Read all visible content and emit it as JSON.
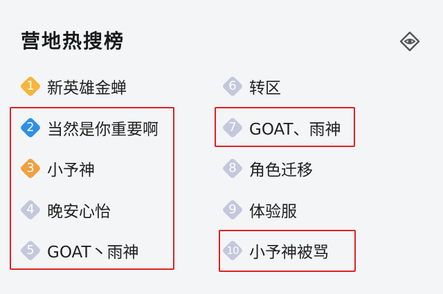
{
  "title": "营地热搜榜",
  "colors": {
    "rank1": "#f5b63a",
    "rank2": "#2f8fe6",
    "rank3": "#f0a040",
    "rankOther": "#c3c8dc",
    "highlight": "#e02020"
  },
  "icons": {
    "more": "diamond-eye-icon"
  },
  "items": [
    {
      "rank": "1",
      "label": "新英雄金蝉",
      "color": "#f5b63a"
    },
    {
      "rank": "2",
      "label": "当然是你重要啊",
      "color": "#2f8fe6"
    },
    {
      "rank": "3",
      "label": "小予神",
      "color": "#f0a040"
    },
    {
      "rank": "4",
      "label": "晚安心怡",
      "color": "#c3c8dc"
    },
    {
      "rank": "5",
      "label": "GOAT丶雨神",
      "color": "#c3c8dc"
    },
    {
      "rank": "6",
      "label": "转区",
      "color": "#c3c8dc"
    },
    {
      "rank": "7",
      "label": "GOAT、雨神",
      "color": "#c3c8dc"
    },
    {
      "rank": "8",
      "label": "角色迁移",
      "color": "#c3c8dc"
    },
    {
      "rank": "9",
      "label": "体验服",
      "color": "#c3c8dc"
    },
    {
      "rank": "10",
      "label": "小予神被骂",
      "color": "#c3c8dc"
    }
  ]
}
